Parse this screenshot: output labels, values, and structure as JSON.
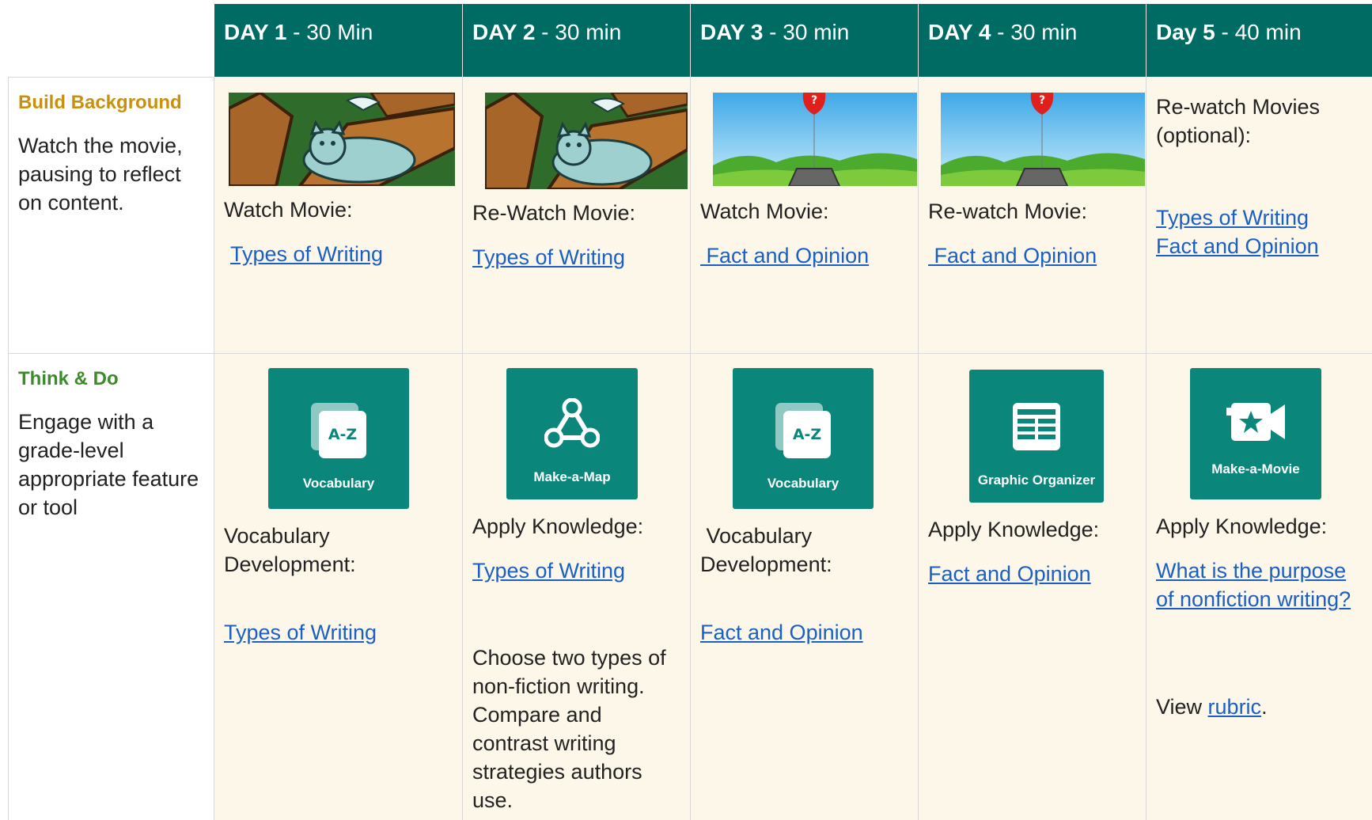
{
  "headers": [
    {
      "day": "DAY 1",
      "duration": " - 30 Min"
    },
    {
      "day": "DAY 2",
      "duration": " - 30 min"
    },
    {
      "day": "DAY 3",
      "duration": " - 30 min"
    },
    {
      "day": "DAY 4",
      "duration": " - 30 min"
    },
    {
      "day": "Day 5",
      "duration": " - 40 min"
    }
  ],
  "rows": {
    "build": {
      "title": "Build Background",
      "desc": "Watch the movie, pausing to reflect on content.",
      "title_color": "#c9900e",
      "cells": [
        {
          "label": "Watch Movie:",
          "link": "Types of Writing",
          "thumb": "cat-in-tree"
        },
        {
          "label": "Re-Watch Movie:",
          "link": "Types of Writing",
          "thumb": "cat-in-tree"
        },
        {
          "label": "Watch Movie:",
          "link": " Fact and Opinion",
          "thumb": "balloon-fact-weight"
        },
        {
          "label": "Re-watch Movie:",
          "link": " Fact and Opinion",
          "thumb": "balloon-fact-weight"
        },
        {
          "label": "Re-watch Movies (optional):",
          "link1": "Types of Writing",
          "link2": "Fact and Opinion"
        }
      ]
    },
    "think": {
      "title": "Think & Do",
      "desc": "Engage with a grade-level appropriate feature or tool",
      "title_color": "#3c8b2b",
      "cells": [
        {
          "tile": "Vocabulary",
          "icon": "vocabulary-cards-icon",
          "label": "Vocabulary Development:",
          "link": "Types of Writing"
        },
        {
          "tile": "Make-a-Map",
          "icon": "concept-map-icon",
          "label": "Apply Knowledge:",
          "link": "Types of Writing",
          "extra": "Choose two types of non-fiction writing. Compare and contrast writing strategies authors use."
        },
        {
          "tile": "Vocabulary",
          "icon": "vocabulary-cards-icon",
          "label": " Vocabulary Development:",
          "link": "Fact and Opinion"
        },
        {
          "tile": "Graphic Organizer",
          "icon": "graphic-organizer-icon",
          "label": "Apply Knowledge:",
          "link": "Fact and Opinion"
        },
        {
          "tile": "Make-a-Movie",
          "icon": "movie-camera-icon",
          "label": "Apply Knowledge:",
          "link": "What is the purpose of nonfiction writing?",
          "view_prefix": "View ",
          "view_link": "rubric",
          "view_suffix": "."
        }
      ]
    }
  },
  "colors": {
    "header": "#006b63",
    "tile": "#0a867b",
    "cell_bg": "#fdf7ea",
    "link": "#1a5fc2"
  }
}
